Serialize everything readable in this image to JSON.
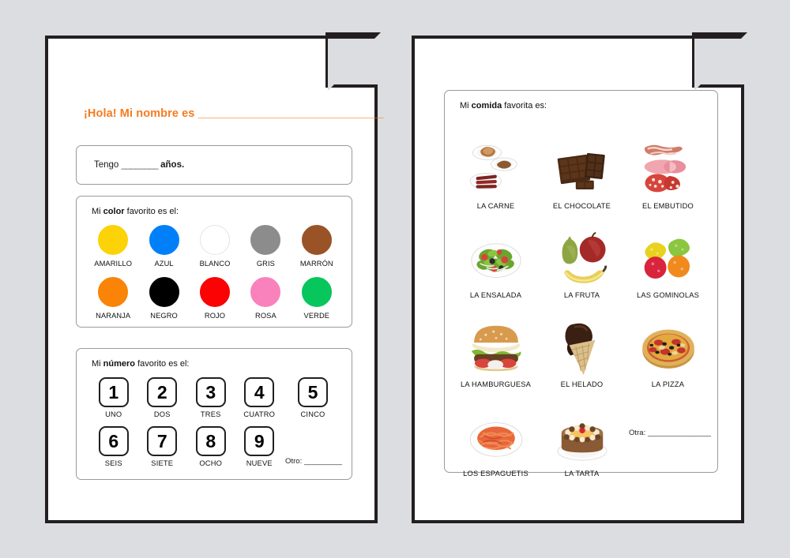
{
  "background_color": "#dcdde1",
  "left_page": {
    "header": {
      "greeting": "¡Hola! Mi nombre es",
      "blank": "_______________________________",
      "color": "#f57b1f"
    },
    "age_box": {
      "prefix": "Tengo",
      "blank": "________",
      "suffix": "años."
    },
    "color_section": {
      "title_prefix": "Mi ",
      "title_bold": "color",
      "title_suffix": " favorito es el:",
      "items": [
        {
          "label": "AMARILLO",
          "color": "#fcd209",
          "border": "#fcd209"
        },
        {
          "label": "AZUL",
          "color": "#0080f8",
          "border": "#0080f8"
        },
        {
          "label": "BLANCO",
          "color": "#ffffff",
          "border": "#e4e4e4"
        },
        {
          "label": "GRIS",
          "color": "#8c8c8c",
          "border": "#8c8c8c"
        },
        {
          "label": "MARRÓN",
          "color": "#9a5327",
          "border": "#9a5327"
        },
        {
          "label": "NARANJA",
          "color": "#f98407",
          "border": "#f98407"
        },
        {
          "label": "NEGRO",
          "color": "#000000",
          "border": "#000000"
        },
        {
          "label": "ROJO",
          "color": "#fb0205",
          "border": "#fb0205"
        },
        {
          "label": "ROSA",
          "color": "#f982bc",
          "border": "#f982bc"
        },
        {
          "label": "VERDE",
          "color": "#07c65c",
          "border": "#07c65c"
        }
      ]
    },
    "number_section": {
      "title_prefix": "Mi ",
      "title_bold": "número",
      "title_suffix": " favorito es el:",
      "items": [
        {
          "digit": "1",
          "label": "UNO"
        },
        {
          "digit": "2",
          "label": "DOS"
        },
        {
          "digit": "3",
          "label": "TRES"
        },
        {
          "digit": "4",
          "label": "CUATRO"
        },
        {
          "digit": "5",
          "label": "CINCO"
        },
        {
          "digit": "6",
          "label": "SEIS"
        },
        {
          "digit": "7",
          "label": "SIETE"
        },
        {
          "digit": "8",
          "label": "OCHO"
        },
        {
          "digit": "9",
          "label": "NUEVE"
        }
      ],
      "other": "Otro: _________"
    }
  },
  "right_page": {
    "food_section": {
      "title_prefix": "Mi ",
      "title_bold": "comida",
      "title_suffix": " favorita es:",
      "items": [
        {
          "label": "LA CARNE",
          "icon": "meat-icon"
        },
        {
          "label": "EL CHOCOLATE",
          "icon": "chocolate-bar-icon"
        },
        {
          "label": "EL EMBUTIDO",
          "icon": "cold-cuts-icon"
        },
        {
          "label": "LA ENSALADA",
          "icon": "salad-bowl-icon"
        },
        {
          "label": "LA FRUTA",
          "icon": "fruit-icon"
        },
        {
          "label": "LAS GOMINOLAS",
          "icon": "gummy-candy-icon"
        },
        {
          "label": "LA HAMBURGUESA",
          "icon": "hamburger-icon"
        },
        {
          "label": "EL HELADO",
          "icon": "ice-cream-cone-icon"
        },
        {
          "label": "LA PIZZA",
          "icon": "pizza-icon"
        },
        {
          "label": "LOS ESPAGUETIS",
          "icon": "spaghetti-icon"
        },
        {
          "label": "LA TARTA",
          "icon": "cake-icon"
        }
      ],
      "other": "Otra: _______________"
    }
  }
}
